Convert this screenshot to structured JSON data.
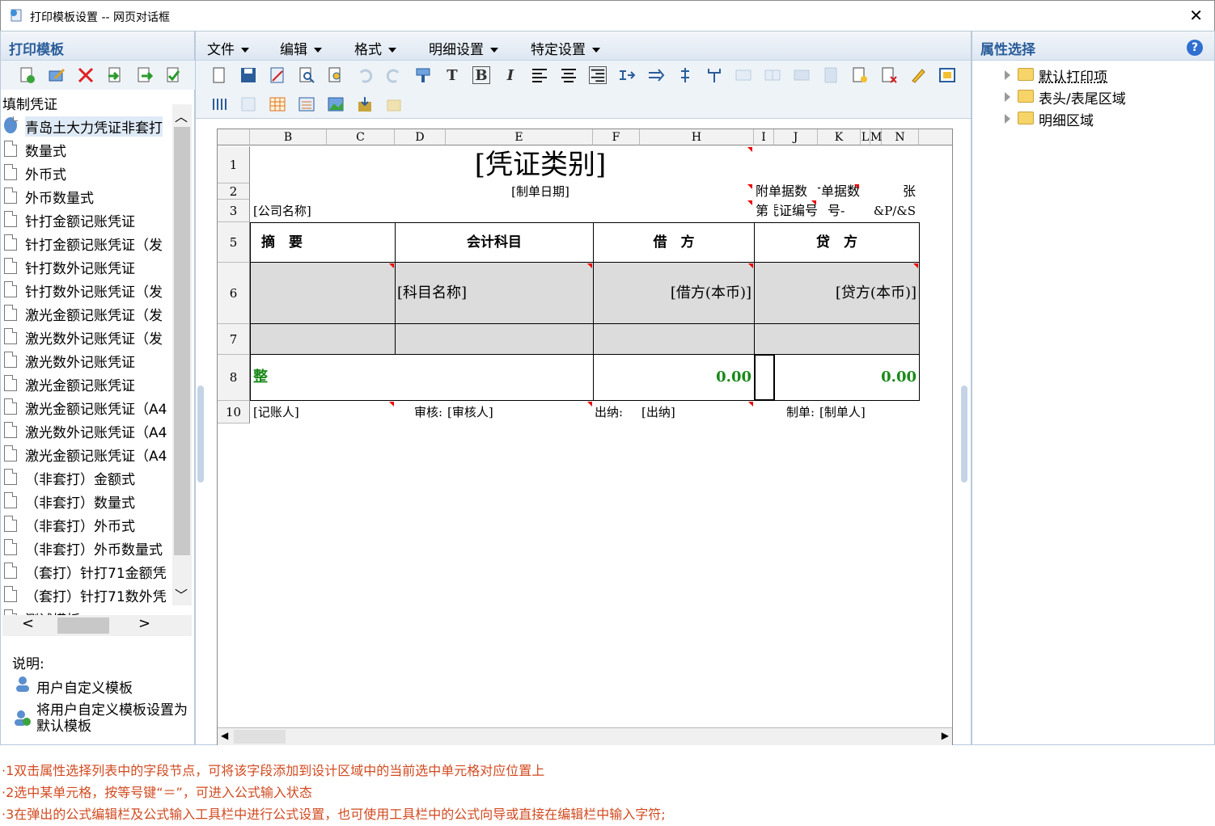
{
  "window": {
    "title": "打印模板设置 -- 网页对话框",
    "close": "✕"
  },
  "left": {
    "header": "打印模板",
    "group": "填制凭证",
    "items": [
      "青岛土大力凭证非套打",
      "数量式",
      "外币式",
      "外币数量式",
      "针打金额记账凭证",
      "针打金额记账凭证（发",
      "针打数外记账凭证",
      "针打数外记账凭证（发",
      "激光金额记账凭证（发",
      "激光数外记账凭证（发",
      "激光数外记账凭证",
      "激光金额记账凭证",
      "激光金额记账凭证（A4",
      "激光数外记账凭证（A4",
      "激光金额记账凭证（A4",
      "（非套打）金额式",
      "（非套打）数量式",
      "（非套打）外币式",
      "（非套打）外币数量式",
      "（套打）针打71金额凭",
      "（套打）针打71数外凭",
      "测试模板"
    ],
    "note_label": "说明:",
    "note1": "用户自定义模板",
    "note2": "将用户自定义模板设置为默认模板"
  },
  "menu": [
    "文件",
    "编辑",
    "格式",
    "明细设置",
    "特定设置"
  ],
  "sheet": {
    "cols": [
      "B",
      "C",
      "D",
      "E",
      "F",
      "H",
      "I",
      "J",
      "K",
      "L",
      "M",
      "N"
    ],
    "rows": [
      "1",
      "2",
      "3",
      "5",
      "6",
      "7",
      "8",
      "10"
    ],
    "title": "[凭证类别]",
    "date": "[制单日期]",
    "attach": "附单据数",
    "attach2": "寸单据数",
    "zhang": "张",
    "company": "[公司名称]",
    "di": "第",
    "vno": "凭证编号",
    "hao": "号-",
    "page": "&P/&S",
    "h_zy": "摘　要",
    "h_km": "会计科目",
    "h_jf": "借　方",
    "h_df": "贷　方",
    "km": "[科目名称]",
    "jf": "[借方(本币)]",
    "df": "[贷方(本币)]",
    "zheng": "整",
    "sum1": "0.00",
    "sum2": "0.00",
    "jzr": "[记账人]",
    "sh": "审核:",
    "shr": "[审核人]",
    "cn": "出纳:",
    "cnr": "[出纳]",
    "zd": "制单:",
    "zdr": "[制单人]"
  },
  "right": {
    "header": "属性选择",
    "tree": [
      "默认打印项",
      "表头/表尾区域",
      "明细区域"
    ]
  },
  "footer": [
    "·1双击属性选择列表中的字段节点，可将该字段添加到设计区域中的当前选中单元格对应位置上",
    "·2选中某单元格，按等号键“＝”，可进入公式输入状态",
    "·3在弹出的公式编辑栏及公式输入工具栏中进行公式设置，也可使用工具栏中的公式向导或直接在编辑栏中输入字符;"
  ],
  "colors": {
    "accent": "#2a5d9a",
    "note": "#d24a1f",
    "sum": "#1a8a1a"
  }
}
